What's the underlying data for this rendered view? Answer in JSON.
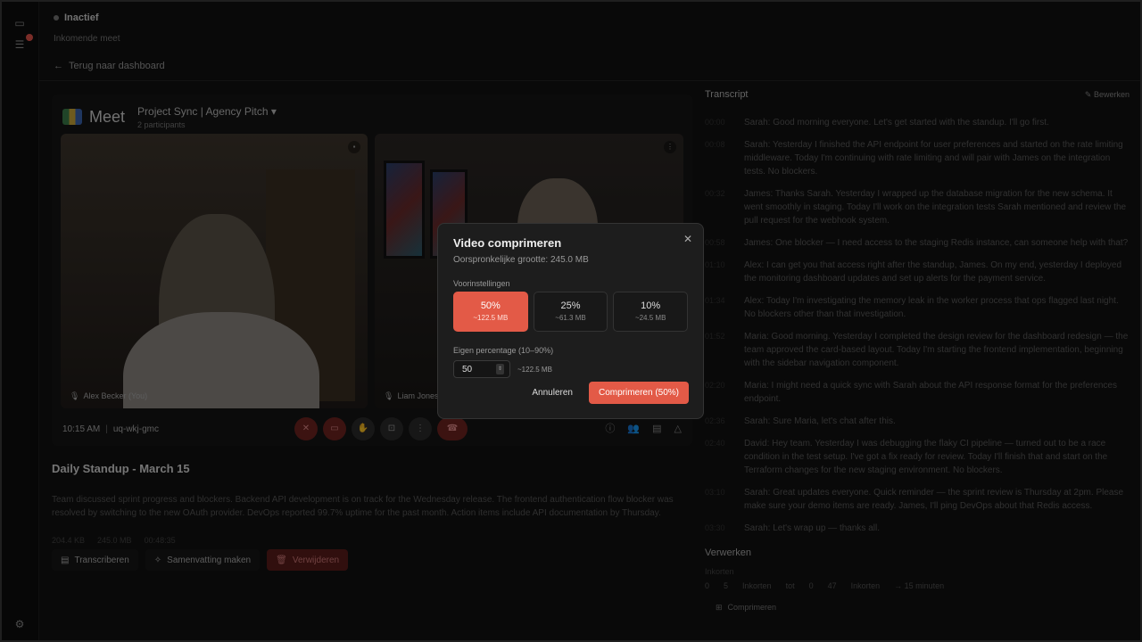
{
  "header": {
    "status": "Inactief",
    "subtitle": "Inkomende meet",
    "back_label": "Terug naar dashboard"
  },
  "meet": {
    "logo_text": "Meet",
    "title": "Project Sync | Agency Pitch",
    "participants": "2 participants",
    "tiles": [
      {
        "name": "Alex Becker (You)"
      },
      {
        "name": "Liam Jones"
      }
    ],
    "time": "10:15 AM",
    "code": "uq-wkj-gmc"
  },
  "daily": {
    "title": "Daily Standup - March 15",
    "description": "Team discussed sprint progress and blockers. Backend API development is on track for the Wednesday release. The frontend authentication flow blocker was resolved by switching to the new OAuth provider. DevOps reported 99.7% uptime for the past month. Action items include API documentation by Thursday.",
    "meta": [
      "204.4 KB",
      "245.0 MB",
      "00:48:35"
    ],
    "actions": {
      "transcribe": "Transcriberen",
      "summary": "Samenvatting maken",
      "delete": "Verwijderen"
    }
  },
  "transcript": {
    "title": "Transcript",
    "edit": "Bewerken",
    "entries": [
      {
        "ts": "00:00",
        "text": "Sarah: Good morning everyone. Let's get started with the standup. I'll go first."
      },
      {
        "ts": "00:08",
        "text": "Sarah: Yesterday I finished the API endpoint for user preferences and started on the rate limiting middleware. Today I'm continuing with rate limiting and will pair with James on the integration tests. No blockers."
      },
      {
        "ts": "00:32",
        "text": "James: Thanks Sarah. Yesterday I wrapped up the database migration for the new schema. It went smoothly in staging. Today I'll work on the integration tests Sarah mentioned and review the pull request for the webhook system."
      },
      {
        "ts": "00:58",
        "text": "James: One blocker — I need access to the staging Redis instance, can someone help with that?"
      },
      {
        "ts": "01:10",
        "text": "Alex: I can get you that access right after the standup, James. On my end, yesterday I deployed the monitoring dashboard updates and set up alerts for the payment service."
      },
      {
        "ts": "01:34",
        "text": "Alex: Today I'm investigating the memory leak in the worker process that ops flagged last night. No blockers other than that investigation."
      },
      {
        "ts": "01:52",
        "text": "Maria: Good morning. Yesterday I completed the design review for the dashboard redesign — the team approved the card-based layout. Today I'm starting the frontend implementation, beginning with the sidebar navigation component."
      },
      {
        "ts": "02:20",
        "text": "Maria: I might need a quick sync with Sarah about the API response format for the preferences endpoint."
      },
      {
        "ts": "02:36",
        "text": "Sarah: Sure Maria, let's chat after this."
      },
      {
        "ts": "02:40",
        "text": "David: Hey team. Yesterday I was debugging the flaky CI pipeline — turned out to be a race condition in the test setup. I've got a fix ready for review. Today I'll finish that and start on the Terraform changes for the new staging environment. No blockers."
      },
      {
        "ts": "03:10",
        "text": "Sarah: Great updates everyone. Quick reminder — the sprint review is Thursday at 2pm. Please make sure your demo items are ready. James, I'll ping DevOps about that Redis access."
      },
      {
        "ts": "03:30",
        "text": "Sarah: Let's wrap up — thanks all."
      }
    ]
  },
  "process": {
    "title": "Verwerken",
    "sub": "Inkorten",
    "row": [
      "0",
      "5",
      "Inkorten",
      "tot",
      "0",
      "47",
      "Inkorten",
      "→ 15 minuten"
    ],
    "compress_btn": "Comprimeren"
  },
  "modal": {
    "title": "Video comprimeren",
    "original": "Oorspronkelijke grootte: 245.0 MB",
    "presets_label": "Voorinstellingen",
    "presets": [
      {
        "pct": "50%",
        "size": "~122.5 MB"
      },
      {
        "pct": "25%",
        "size": "~61.3 MB"
      },
      {
        "pct": "10%",
        "size": "~24.5 MB"
      }
    ],
    "custom_label": "Eigen percentage (10–90%)",
    "custom_value": "50",
    "custom_size": "~122.5 MB",
    "cancel": "Annuleren",
    "confirm": "Comprimeren (50%)",
    "accent": "#e35a47"
  }
}
